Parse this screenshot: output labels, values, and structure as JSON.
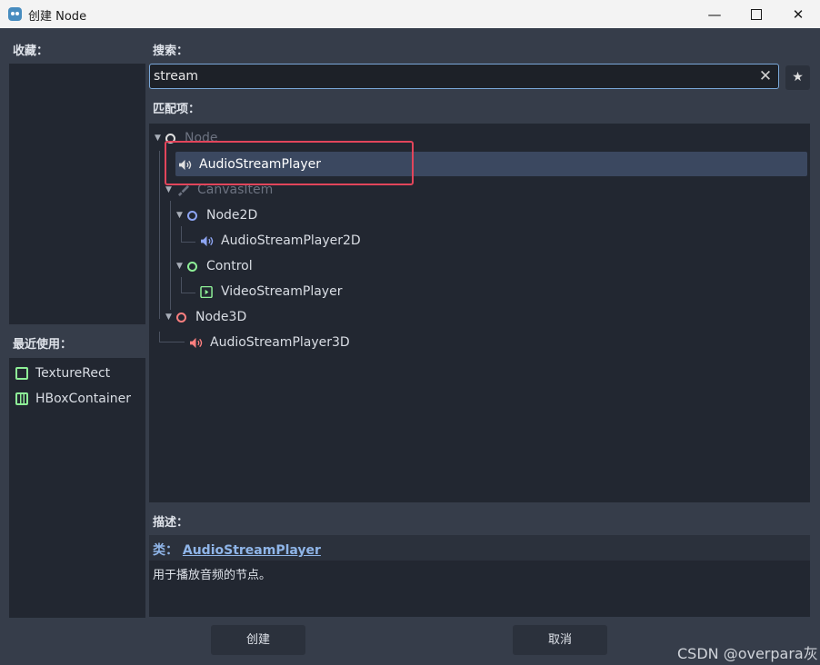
{
  "window": {
    "title": "创建 Node",
    "minimize": "—",
    "maximize": "",
    "close": "✕"
  },
  "favorites": {
    "label": "收藏："
  },
  "recent": {
    "label": "最近使用：",
    "items": [
      {
        "label": "TextureRect"
      },
      {
        "label": "HBoxContainer"
      }
    ]
  },
  "search": {
    "label": "搜索：",
    "value": "stream",
    "clear": "✕",
    "favorite": "★"
  },
  "matches": {
    "label": "匹配项：",
    "tree": [
      {
        "label": "Node"
      },
      {
        "label": "AudioStreamPlayer"
      },
      {
        "label": "CanvasItem"
      },
      {
        "label": "Node2D"
      },
      {
        "label": "AudioStreamPlayer2D"
      },
      {
        "label": "Control"
      },
      {
        "label": "VideoStreamPlayer"
      },
      {
        "label": "Node3D"
      },
      {
        "label": "AudioStreamPlayer3D"
      }
    ]
  },
  "description": {
    "label": "描述：",
    "class_prefix": "类：",
    "class_name": "AudioStreamPlayer",
    "text": "用于播放音频的节点。"
  },
  "buttons": {
    "create": "创建",
    "cancel": "取消"
  },
  "watermark": "CSDN @overpara灰",
  "colors": {
    "accent": "#7aa8d9",
    "highlight": "#3b4860",
    "callout": "#e2455b",
    "node2d": "#8da5f3",
    "control": "#8eef97",
    "node3d": "#fc7f7f"
  }
}
